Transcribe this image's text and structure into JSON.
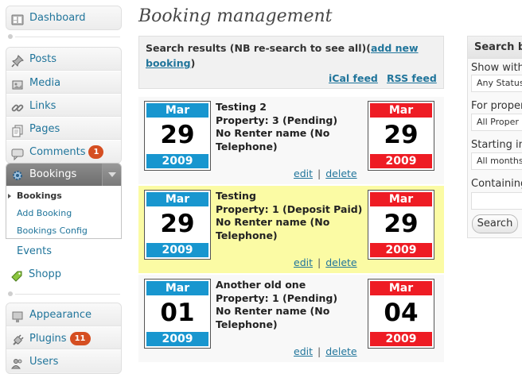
{
  "sidebar": {
    "dashboard": "Dashboard",
    "posts": "Posts",
    "media": "Media",
    "links": "Links",
    "pages": "Pages",
    "comments": "Comments",
    "comments_badge": "1",
    "bookings": "Bookings",
    "bookings_sub": [
      "Bookings",
      "Add Booking",
      "Bookings Config"
    ],
    "events": "Events",
    "shopp": "Shopp",
    "appearance": "Appearance",
    "plugins": "Plugins",
    "plugins_badge": "11",
    "users": "Users"
  },
  "main": {
    "title": "Booking management",
    "search_results_text": "Search results (NB re-search to see all)(",
    "add_new_booking": "add new booking",
    "search_results_close": ")",
    "ical_feed": "iCal feed",
    "rss_feed": "RSS feed"
  },
  "bookings": [
    {
      "title": "Testing 2",
      "property": "Property: 3 (Pending)",
      "renter": "No Renter name (No Telephone)",
      "start": {
        "month": "Mar",
        "day": "29",
        "year": "2009"
      },
      "end": {
        "month": "Mar",
        "day": "29",
        "year": "2009"
      },
      "edit": "edit",
      "delete": "delete",
      "highlight": false
    },
    {
      "title": "Testing",
      "property": "Property: 1 (Deposit Paid)",
      "renter": "No Renter name (No Telephone)",
      "start": {
        "month": "Mar",
        "day": "29",
        "year": "2009"
      },
      "end": {
        "month": "Mar",
        "day": "29",
        "year": "2009"
      },
      "edit": "edit",
      "delete": "delete",
      "highlight": true
    },
    {
      "title": "Another old one",
      "property": "Property: 1 (Pending)",
      "renter": "No Renter name (No Telephone)",
      "start": {
        "month": "Mar",
        "day": "01",
        "year": "2009"
      },
      "end": {
        "month": "Mar",
        "day": "04",
        "year": "2009"
      },
      "edit": "edit",
      "delete": "delete",
      "highlight": false
    }
  ],
  "filter": {
    "title": "Search b",
    "show_label": "Show with",
    "status_value": "Any Status",
    "property_label": "For proper",
    "property_value": "All Proper",
    "starting_label": "Starting in",
    "starting_value": "All months",
    "containing_label": "Containing",
    "search_button": "Search"
  },
  "colors": {
    "link": "#21759b",
    "start_calendar": "#1896cf",
    "end_calendar": "#ee1c24",
    "highlight_row": "#fbfba4",
    "badge": "#d54e21"
  }
}
